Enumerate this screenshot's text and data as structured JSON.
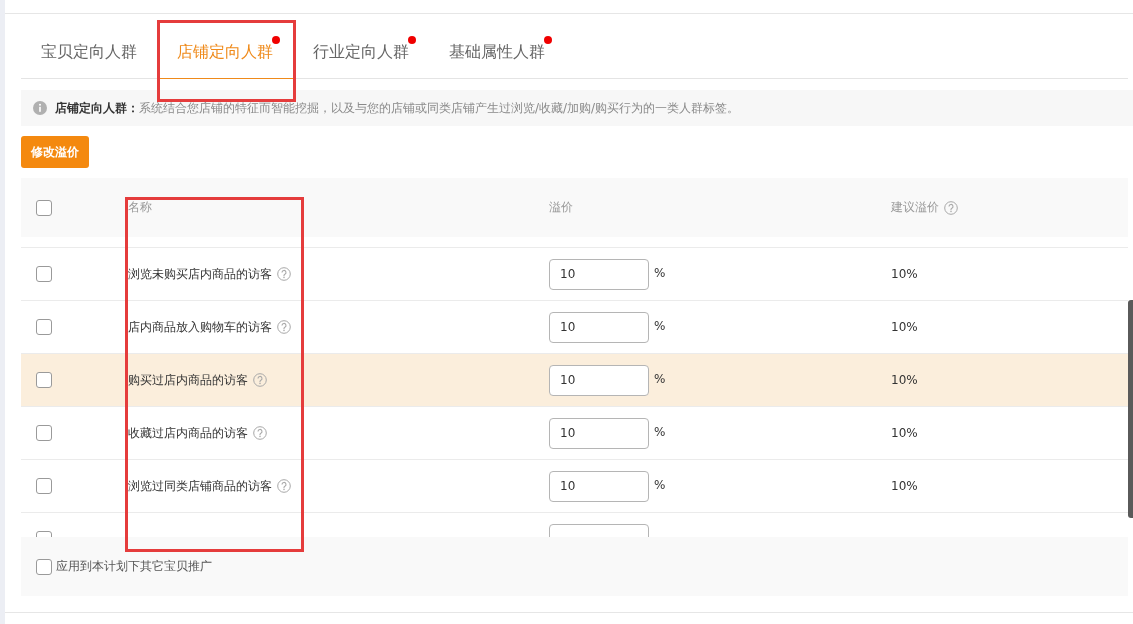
{
  "tabs": [
    {
      "label": "宝贝定向人群",
      "selected": false,
      "dot": false
    },
    {
      "label": "店铺定向人群",
      "selected": true,
      "dot": true
    },
    {
      "label": "行业定向人群",
      "selected": false,
      "dot": true
    },
    {
      "label": "基础属性人群",
      "selected": false,
      "dot": true
    }
  ],
  "info": {
    "text": "**店铺定向人群：**系统结合您店铺的特征而智能挖掘，以及与您的店铺或同类店铺产生过浏览/收藏/加购/购买行为的一类人群标签。"
  },
  "edit_button": {
    "label": "修改溢价"
  },
  "table": {
    "select_all": {
      "checked": false
    },
    "columns": [
      {
        "label": "名称",
        "help": false
      },
      {
        "label": "溢价",
        "help": false
      },
      {
        "label": "建议溢价",
        "help": true
      }
    ],
    "rows": [
      {
        "checked": false,
        "hovered": false,
        "name": "浏览未购买店内商品的访客",
        "premium": "10",
        "unit": "%",
        "suggested": "10%"
      },
      {
        "checked": false,
        "hovered": false,
        "name": "店内商品放入购物车的访客",
        "premium": "10",
        "unit": "%",
        "suggested": "10%"
      },
      {
        "checked": false,
        "hovered": true,
        "name": "购买过店内商品的访客",
        "premium": "10",
        "unit": "%",
        "suggested": "10%"
      },
      {
        "checked": false,
        "hovered": false,
        "name": "收藏过店内商品的访客",
        "premium": "10",
        "unit": "%",
        "suggested": "10%"
      },
      {
        "checked": false,
        "hovered": false,
        "name": "浏览过同类店铺商品的访客",
        "premium": "10",
        "unit": "%",
        "suggested": "10%"
      },
      {
        "checked": false,
        "hovered": false
      }
    ]
  },
  "footer": {
    "label": "应用到本计划下其它宝贝推广",
    "checked": false
  }
}
